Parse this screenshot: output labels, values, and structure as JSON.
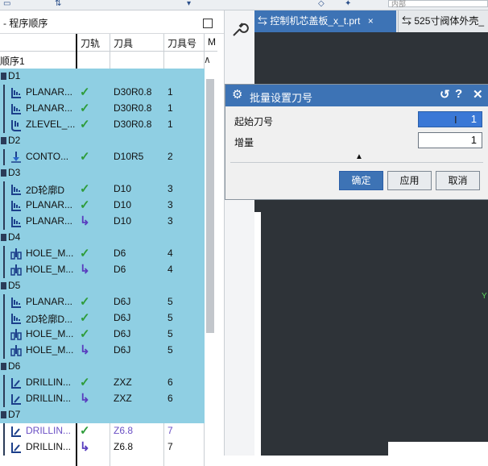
{
  "nav": {
    "title": "- 程序顺序",
    "columns": {
      "rail": "刀轨",
      "tool": "刀具",
      "toolnum": "刀具号",
      "more": "M"
    },
    "root_label": "顺序1",
    "scroll_up_glyph": "∧",
    "rows": [
      {
        "type": "group",
        "label": "D1",
        "sel": true
      },
      {
        "type": "op",
        "label": "PLANAR...",
        "rail": "check",
        "tool": "D30R0.8",
        "num": "1",
        "sel": true,
        "icon": "planar-mill-icon"
      },
      {
        "type": "op",
        "label": "PLANAR...",
        "rail": "check",
        "tool": "D30R0.8",
        "num": "1",
        "sel": true,
        "icon": "planar-mill-icon"
      },
      {
        "type": "op",
        "label": "ZLEVEL_...",
        "rail": "check",
        "tool": "D30R0.8",
        "num": "1",
        "sel": true,
        "icon": "zlevel-mill-icon"
      },
      {
        "type": "group",
        "label": "D2",
        "sel": true
      },
      {
        "type": "op",
        "label": "CONTO...",
        "rail": "check",
        "tool": "D10R5",
        "num": "2",
        "sel": true,
        "icon": "contour-mill-icon"
      },
      {
        "type": "group",
        "label": "D3",
        "sel": true
      },
      {
        "type": "op",
        "label": "2D轮廓D",
        "rail": "check",
        "tool": "D10",
        "num": "3",
        "sel": true,
        "icon": "planar-mill-icon"
      },
      {
        "type": "op",
        "label": "PLANAR...",
        "rail": "check",
        "tool": "D10",
        "num": "3",
        "sel": true,
        "icon": "planar-mill-icon"
      },
      {
        "type": "op",
        "label": "PLANAR...",
        "rail": "arrow",
        "tool": "D10",
        "num": "3",
        "sel": true,
        "icon": "planar-mill-icon"
      },
      {
        "type": "group",
        "label": "D4",
        "sel": true
      },
      {
        "type": "op",
        "label": "HOLE_M...",
        "rail": "check",
        "tool": "D6",
        "num": "4",
        "sel": true,
        "icon": "hole-mill-icon"
      },
      {
        "type": "op",
        "label": "HOLE_M...",
        "rail": "arrow",
        "tool": "D6",
        "num": "4",
        "sel": true,
        "icon": "hole-mill-icon"
      },
      {
        "type": "group",
        "label": "D5",
        "sel": true
      },
      {
        "type": "op",
        "label": "PLANAR...",
        "rail": "check",
        "tool": "D6J",
        "num": "5",
        "sel": true,
        "icon": "planar-mill-icon"
      },
      {
        "type": "op",
        "label": "2D轮廓D...",
        "rail": "check",
        "tool": "D6J",
        "num": "5",
        "sel": true,
        "icon": "planar-mill-icon"
      },
      {
        "type": "op",
        "label": "HOLE_M...",
        "rail": "check",
        "tool": "D6J",
        "num": "5",
        "sel": true,
        "icon": "hole-mill-icon"
      },
      {
        "type": "op",
        "label": "HOLE_M...",
        "rail": "arrow",
        "tool": "D6J",
        "num": "5",
        "sel": true,
        "icon": "hole-mill-icon"
      },
      {
        "type": "group",
        "label": "D6",
        "sel": true
      },
      {
        "type": "op",
        "label": "DRILLIN...",
        "rail": "check",
        "tool": "ZXZ",
        "num": "6",
        "sel": true,
        "icon": "drilling-icon"
      },
      {
        "type": "op",
        "label": "DRILLIN...",
        "rail": "arrow",
        "tool": "ZXZ",
        "num": "6",
        "sel": true,
        "icon": "drilling-icon"
      },
      {
        "type": "group",
        "label": "D7",
        "sel": true
      },
      {
        "type": "op",
        "label": "DRILLIN...",
        "rail": "check",
        "tool": "Z6.8",
        "num": "7",
        "sel": false,
        "purple": true,
        "icon": "drilling-icon"
      },
      {
        "type": "op",
        "label": "DRILLIN...",
        "rail": "arrow",
        "tool": "Z6.8",
        "num": "7",
        "sel": false,
        "icon": "drilling-icon"
      }
    ]
  },
  "tabs": [
    {
      "label": "控制机芯盖板_x_t.prt",
      "close": "×",
      "active": true
    },
    {
      "label": "525寸阀体外壳_",
      "active": false
    }
  ],
  "toolbar": {
    "search_placeholder": "内部"
  },
  "dialog": {
    "title": "批量设置刀号",
    "title_buttons": {
      "reset": "↺",
      "help": "?",
      "close": "✕"
    },
    "start_label": "起始刀号",
    "start_value": "1",
    "increment_label": "增量",
    "increment_value": "1",
    "collapse_glyph": "▲",
    "ok": "确定",
    "apply": "应用",
    "cancel": "取消"
  },
  "colors": {
    "selection": "#8fcfe3",
    "accent": "#3d73b5",
    "check": "#2e9c3a",
    "arrow": "#5a3fbf",
    "viewport": "#2e3338"
  }
}
